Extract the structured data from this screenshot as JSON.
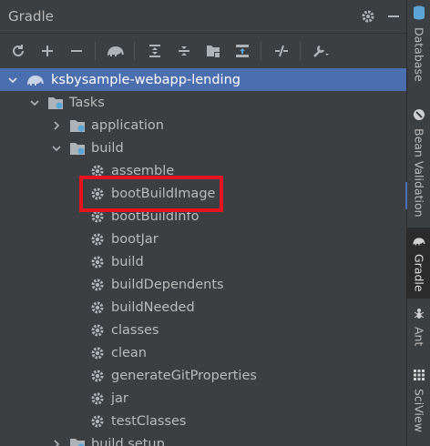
{
  "header": {
    "title": "Gradle"
  },
  "toolbar": {
    "buttons": [
      "refresh-icon",
      "add-icon",
      "remove-icon",
      "elephant-icon",
      "expand-all-icon",
      "collapse-all-icon",
      "group-modules-icon",
      "toggle-offline-icon",
      "offline-mode-icon",
      "settings-wrench-icon"
    ]
  },
  "tree": {
    "root": "ksbysample-webapp-lending",
    "tasks": "Tasks",
    "application": "application",
    "build": "build",
    "items": [
      "assemble",
      "bootBuildImage",
      "bootBuildInfo",
      "bootJar",
      "build",
      "buildDependents",
      "buildNeeded",
      "classes",
      "clean",
      "generateGitProperties",
      "jar",
      "testClasses"
    ],
    "build_setup": "build setup"
  },
  "sidebar": {
    "database": "Database",
    "bean_validation": "Bean Validation",
    "gradle": "Gradle",
    "ant": "Ant",
    "sciview": "SciView"
  },
  "colors": {
    "selection": "#4b6eaf",
    "highlight_box": "#e3131f",
    "background": "#3c3f41"
  }
}
